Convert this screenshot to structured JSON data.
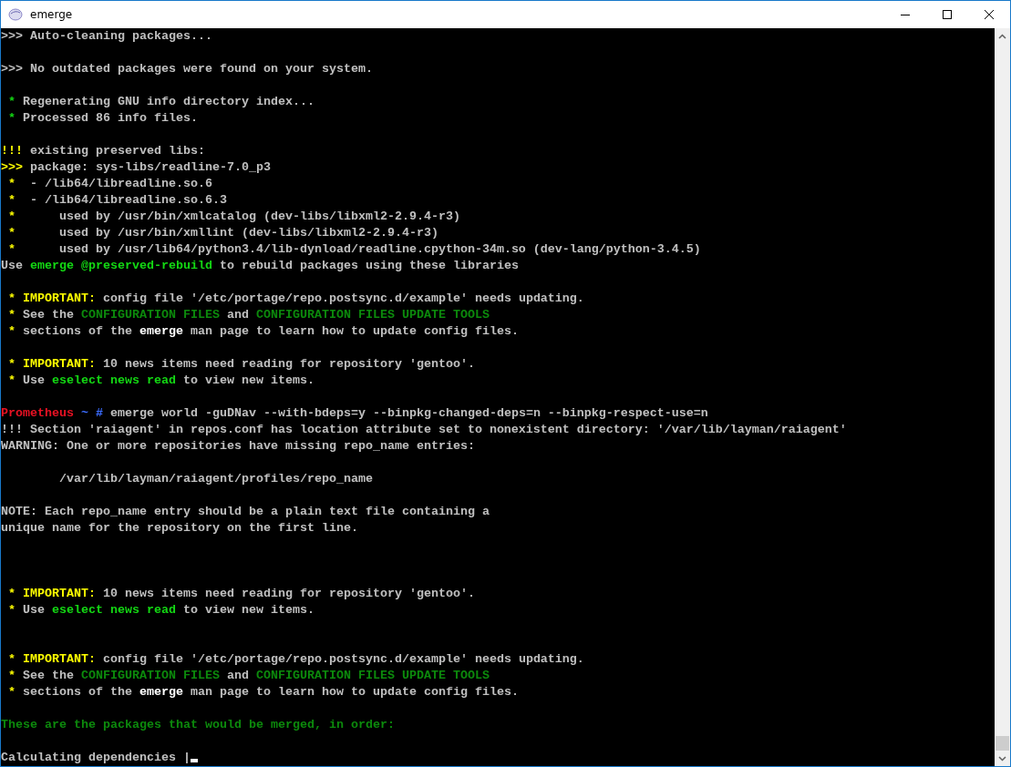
{
  "window": {
    "title": "emerge"
  },
  "terminal": {
    "lines": [
      {
        "kind": "text",
        "segments": [
          {
            "text": ">>> Auto-cleaning packages...",
            "kind": "plain"
          }
        ]
      },
      {
        "kind": "blank"
      },
      {
        "kind": "text",
        "segments": [
          {
            "text": ">>> No outdated packages were found on your system.",
            "kind": "plain"
          }
        ]
      },
      {
        "kind": "blank"
      },
      {
        "kind": "text",
        "segments": [
          {
            "text": " *",
            "kind": "good"
          },
          {
            "text": " Regenerating GNU info directory index...",
            "kind": "plain"
          }
        ]
      },
      {
        "kind": "text",
        "segments": [
          {
            "text": " *",
            "kind": "good"
          },
          {
            "text": " Processed 86 info files.",
            "kind": "plain"
          }
        ]
      },
      {
        "kind": "blank"
      },
      {
        "kind": "text",
        "segments": [
          {
            "text": "!!!",
            "kind": "warn"
          },
          {
            "text": " existing preserved libs:",
            "kind": "plain"
          }
        ]
      },
      {
        "kind": "text",
        "segments": [
          {
            "text": ">>>",
            "kind": "warn"
          },
          {
            "text": " package: sys-libs/readline-7.0_p3",
            "kind": "plain"
          }
        ]
      },
      {
        "kind": "text",
        "segments": [
          {
            "text": " *",
            "kind": "warn"
          },
          {
            "text": "  - /lib64/libreadline.so.6",
            "kind": "plain"
          }
        ]
      },
      {
        "kind": "text",
        "segments": [
          {
            "text": " *",
            "kind": "warn"
          },
          {
            "text": "  - /lib64/libreadline.so.6.3",
            "kind": "plain"
          }
        ]
      },
      {
        "kind": "text",
        "segments": [
          {
            "text": " *",
            "kind": "warn"
          },
          {
            "text": "      used by /usr/bin/xmlcatalog (dev-libs/libxml2-2.9.4-r3)",
            "kind": "plain"
          }
        ]
      },
      {
        "kind": "text",
        "segments": [
          {
            "text": " *",
            "kind": "warn"
          },
          {
            "text": "      used by /usr/bin/xmllint (dev-libs/libxml2-2.9.4-r3)",
            "kind": "plain"
          }
        ]
      },
      {
        "kind": "text",
        "segments": [
          {
            "text": " *",
            "kind": "warn"
          },
          {
            "text": "      used by /usr/lib64/python3.4/lib-dynload/readline.cpython-34m.so (dev-lang/python-3.4.5)",
            "kind": "plain"
          }
        ]
      },
      {
        "kind": "text",
        "segments": [
          {
            "text": "Use ",
            "kind": "plain"
          },
          {
            "text": "emerge @preserved-rebuild",
            "kind": "good"
          },
          {
            "text": " to rebuild packages using these libraries",
            "kind": "plain"
          }
        ]
      },
      {
        "kind": "blank"
      },
      {
        "kind": "text",
        "segments": [
          {
            "text": " * IMPORTANT:",
            "kind": "warn"
          },
          {
            "text": " config file '/etc/portage/repo.postsync.d/example' needs updating.",
            "kind": "plain"
          }
        ]
      },
      {
        "kind": "text",
        "segments": [
          {
            "text": " *",
            "kind": "warn"
          },
          {
            "text": " See the ",
            "kind": "plain"
          },
          {
            "text": "CONFIGURATION FILES",
            "kind": "info"
          },
          {
            "text": " and ",
            "kind": "plain"
          },
          {
            "text": "CONFIGURATION FILES UPDATE TOOLS",
            "kind": "info"
          }
        ]
      },
      {
        "kind": "text",
        "segments": [
          {
            "text": " *",
            "kind": "warn"
          },
          {
            "text": " sections of the ",
            "kind": "plain"
          },
          {
            "text": "emerge",
            "kind": "bright"
          },
          {
            "text": " man page to learn how to update config files.",
            "kind": "plain"
          }
        ]
      },
      {
        "kind": "blank"
      },
      {
        "kind": "text",
        "segments": [
          {
            "text": " * IMPORTANT:",
            "kind": "warn"
          },
          {
            "text": " 10 news items need reading for repository 'gentoo'.",
            "kind": "plain"
          }
        ]
      },
      {
        "kind": "text",
        "segments": [
          {
            "text": " *",
            "kind": "warn"
          },
          {
            "text": " Use ",
            "kind": "plain"
          },
          {
            "text": "eselect news read",
            "kind": "good"
          },
          {
            "text": " to view new items.",
            "kind": "plain"
          }
        ]
      },
      {
        "kind": "blank"
      },
      {
        "kind": "text",
        "segments": [
          {
            "text": "Prometheus",
            "kind": "user"
          },
          {
            "text": " ~ #",
            "kind": "path"
          },
          {
            "text": " emerge world -guDNav --with-bdeps=y --binpkg-changed-deps=n --binpkg-respect-use=n",
            "kind": "plain"
          }
        ]
      },
      {
        "kind": "text",
        "segments": [
          {
            "text": "!!! Section 'raiagent' in repos.conf has location attribute set to nonexistent directory: '/var/lib/layman/raiagent'",
            "kind": "plain"
          }
        ]
      },
      {
        "kind": "text",
        "segments": [
          {
            "text": "WARNING: One or more repositories have missing repo_name entries:",
            "kind": "plain"
          }
        ]
      },
      {
        "kind": "blank"
      },
      {
        "kind": "text",
        "segments": [
          {
            "text": "        /var/lib/layman/raiagent/profiles/repo_name",
            "kind": "plain"
          }
        ]
      },
      {
        "kind": "blank"
      },
      {
        "kind": "text",
        "segments": [
          {
            "text": "NOTE: Each repo_name entry should be a plain text file containing a",
            "kind": "plain"
          }
        ]
      },
      {
        "kind": "text",
        "segments": [
          {
            "text": "unique name for the repository on the first line.",
            "kind": "plain"
          }
        ]
      },
      {
        "kind": "blank"
      },
      {
        "kind": "blank"
      },
      {
        "kind": "blank"
      },
      {
        "kind": "text",
        "segments": [
          {
            "text": " * IMPORTANT:",
            "kind": "warn"
          },
          {
            "text": " 10 news items need reading for repository 'gentoo'.",
            "kind": "plain"
          }
        ]
      },
      {
        "kind": "text",
        "segments": [
          {
            "text": " *",
            "kind": "warn"
          },
          {
            "text": " Use ",
            "kind": "plain"
          },
          {
            "text": "eselect news read",
            "kind": "good"
          },
          {
            "text": " to view new items.",
            "kind": "plain"
          }
        ]
      },
      {
        "kind": "blank"
      },
      {
        "kind": "blank"
      },
      {
        "kind": "text",
        "segments": [
          {
            "text": " * IMPORTANT:",
            "kind": "warn"
          },
          {
            "text": " config file '/etc/portage/repo.postsync.d/example' needs updating.",
            "kind": "plain"
          }
        ]
      },
      {
        "kind": "text",
        "segments": [
          {
            "text": " *",
            "kind": "warn"
          },
          {
            "text": " See the ",
            "kind": "plain"
          },
          {
            "text": "CONFIGURATION FILES",
            "kind": "info"
          },
          {
            "text": " and ",
            "kind": "plain"
          },
          {
            "text": "CONFIGURATION FILES UPDATE TOOLS",
            "kind": "info"
          }
        ]
      },
      {
        "kind": "text",
        "segments": [
          {
            "text": " *",
            "kind": "warn"
          },
          {
            "text": " sections of the ",
            "kind": "plain"
          },
          {
            "text": "emerge",
            "kind": "bright"
          },
          {
            "text": " man page to learn how to update config files.",
            "kind": "plain"
          }
        ]
      },
      {
        "kind": "blank"
      },
      {
        "kind": "text",
        "segments": [
          {
            "text": "These are the packages that would be merged, in order:",
            "kind": "info"
          }
        ]
      },
      {
        "kind": "blank"
      },
      {
        "kind": "prompt",
        "segments": [
          {
            "text": "Calculating dependencies |",
            "kind": "plain"
          }
        ]
      }
    ]
  }
}
